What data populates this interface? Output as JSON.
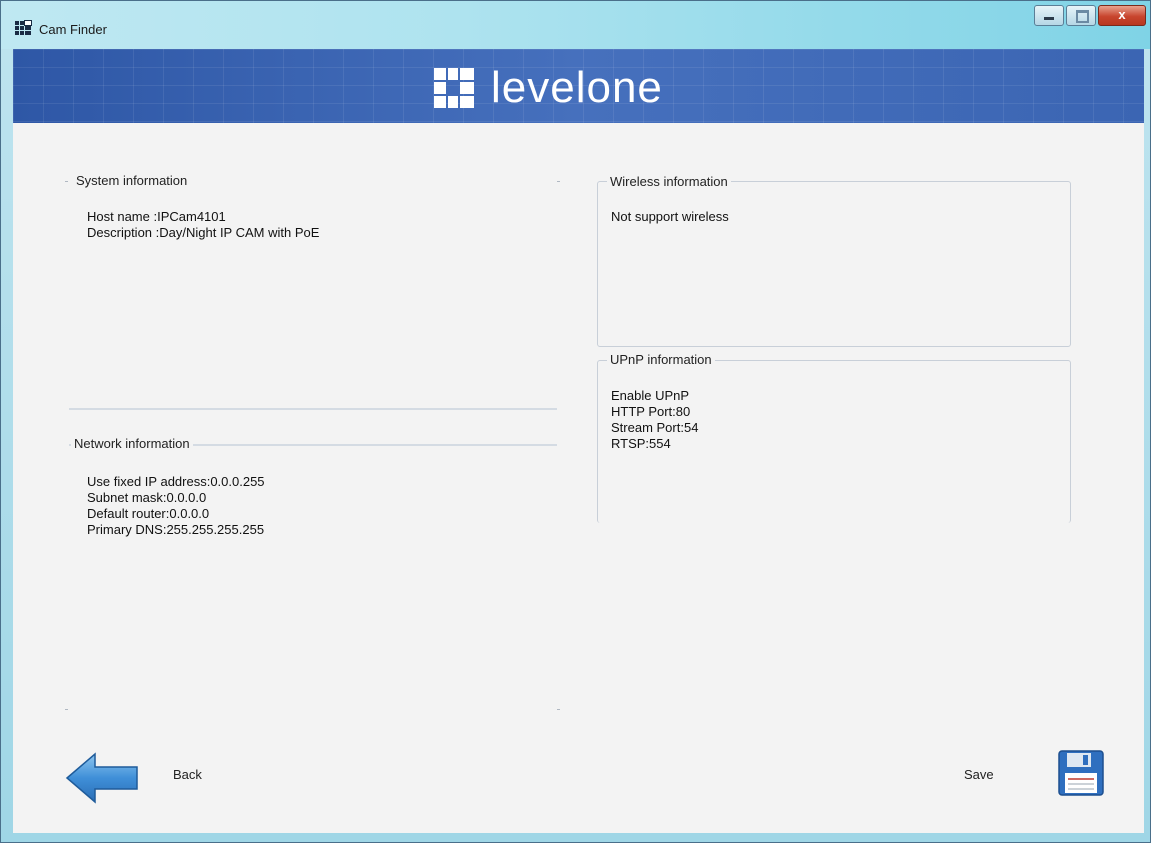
{
  "window": {
    "title": "Cam Finder",
    "close_label": "x"
  },
  "banner": {
    "brand": "levelone"
  },
  "system_info": {
    "legend": "System information",
    "host_name": "Host name :IPCam4101",
    "description": "Description :Day/Night IP CAM with PoE"
  },
  "network_info": {
    "legend": "Network information",
    "fixed_ip": "Use fixed IP address:0.0.0.255",
    "subnet_mask": "Subnet mask:0.0.0.0",
    "default_router": "Default router:0.0.0.0",
    "primary_dns": "Primary DNS:255.255.255.255"
  },
  "wireless_info": {
    "legend": "Wireless information",
    "status": "Not support wireless"
  },
  "upnp_info": {
    "legend": "UPnP information",
    "enable": "Enable UPnP",
    "http_port": "HTTP Port:80",
    "stream_port": "Stream Port:54",
    "rtsp": "RTSP:554"
  },
  "footer": {
    "back_label": "Back",
    "save_label": "Save"
  },
  "colors": {
    "banner": "#3a63b0",
    "panel": "#f3f3f3",
    "titlebar": "#aee3ef"
  }
}
